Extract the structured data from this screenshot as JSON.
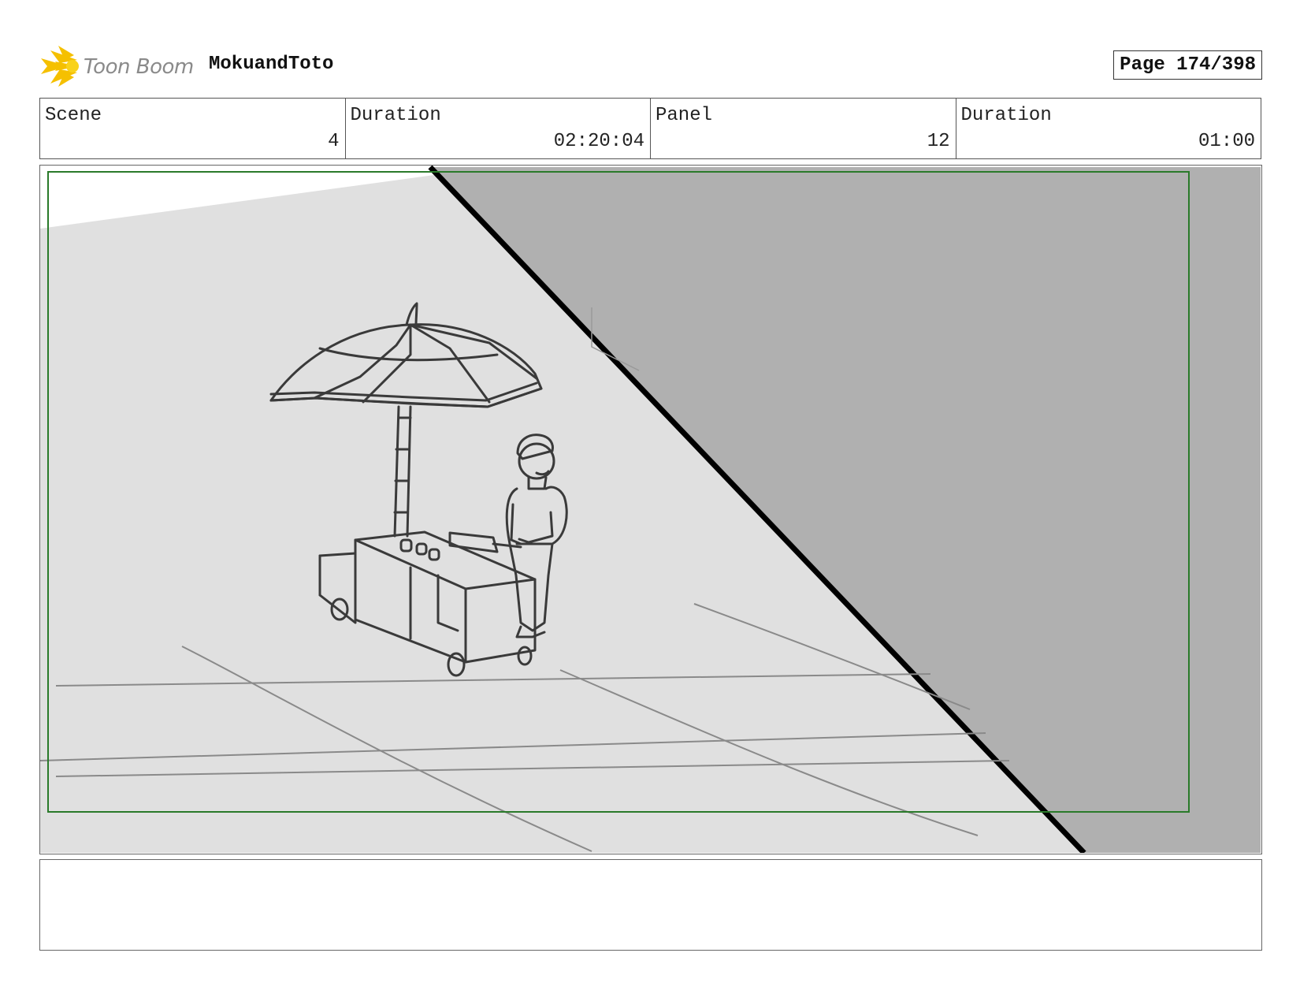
{
  "header": {
    "logo_text": "Toon Boom",
    "project_title": "MokuandToto",
    "page_label": "Page 174/398"
  },
  "info": [
    {
      "label": "Scene",
      "value": "4"
    },
    {
      "label": "Duration",
      "value": "02:20:04"
    },
    {
      "label": "Panel",
      "value": "12"
    },
    {
      "label": "Duration",
      "value": "01:00"
    }
  ],
  "colors": {
    "safe_area_border": "#2a7a2a",
    "shadow_fill": "#b0b0b0",
    "ground_fill": "#e0e0e0",
    "logo_star": "#f5c000"
  },
  "notes": {
    "text": ""
  }
}
